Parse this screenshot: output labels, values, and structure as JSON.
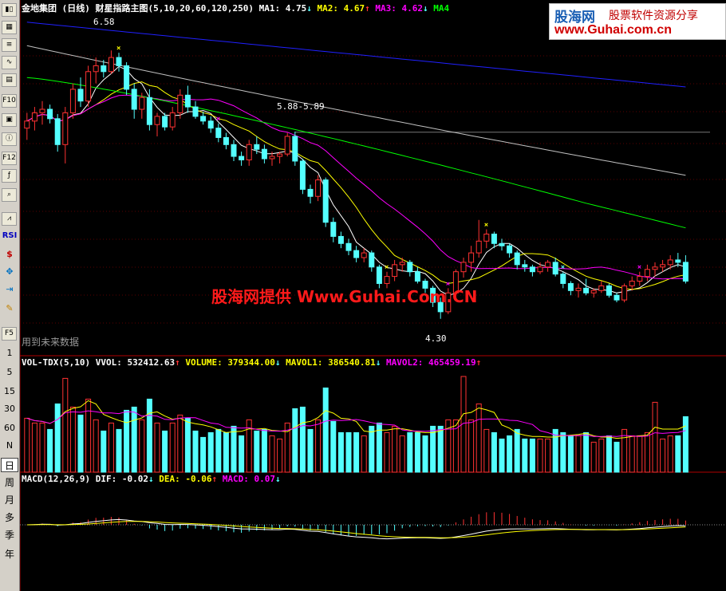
{
  "toolbar": {
    "icon_names": [
      "kline-icon",
      "table-icon",
      "report-icon",
      "fenshi-icon",
      "fundamentals-icon",
      "sector-icon",
      "f10-icon",
      "f9-icon",
      "info-icon",
      "f12-icon",
      "formula-icon",
      "search-icon"
    ],
    "f10_label": "F10",
    "f12_label": "F12",
    "rsi_label": "RSI",
    "f5_label": "F5",
    "minutes": [
      "1",
      "5",
      "15",
      "30",
      "60",
      "N"
    ],
    "periods": [
      "日",
      "周",
      "月",
      "多",
      "季",
      "年"
    ],
    "active_period": "日"
  },
  "main_legend": {
    "title": "金地集团 (日线)",
    "indicator": "财星指路主图(5,10,20,60,120,250)",
    "ma1_label": "MA1:",
    "ma1_value": "4.75",
    "ma1_arrow": "↓",
    "ma2_label": "MA2:",
    "ma2_value": "4.67",
    "ma2_arrow": "↑",
    "ma3_label": "MA3:",
    "ma3_value": "4.62",
    "ma3_arrow": "↓",
    "ma4_label": "MA4"
  },
  "price_annotations": {
    "high": "6.58",
    "range": "5.88-5.89",
    "low": "4.30"
  },
  "future_note": "用到未来数据",
  "volume_legend": {
    "name": "VOL-TDX(5,10)",
    "vvol_label": "VVOL:",
    "vvol_value": "532412.63",
    "vvol_arrow": "↑",
    "volume_label": "VOLUME:",
    "volume_value": "379344.00",
    "volume_arrow": "↓",
    "mavol1_label": "MAVOL1:",
    "mavol1_value": "386540.81",
    "mavol1_arrow": "↓",
    "mavol2_label": "MAVOL2:",
    "mavol2_value": "465459.19",
    "mavol2_arrow": "↑"
  },
  "macd_legend": {
    "name": "MACD(12,26,9)",
    "dif_label": "DIF:",
    "dif_value": "-0.02",
    "dif_arrow": "↓",
    "dea_label": "DEA:",
    "dea_value": "-0.06",
    "dea_arrow": "↑",
    "macd_label": "MACD:",
    "macd_value": "0.07",
    "macd_arrow": "↓"
  },
  "watermark": {
    "logo": "股海网",
    "slogan": "股票软件资源分享",
    "url": "www.Guhai.com.cn",
    "center": "股海网提供 Www.Guhai.Com.CN"
  },
  "colors": {
    "up": "#ff3232",
    "down": "#54ffff",
    "ma5": "#ffffff",
    "ma10": "#ffff00",
    "ma20": "#ff00ff",
    "ma60": "#00ff00",
    "ma120": "#c0c0c0",
    "ma250": "#2020ff",
    "panel_border": "#b00000"
  },
  "chart_data": [
    {
      "type": "candlestick",
      "title": "金地集团 (日线)",
      "price_high": 6.58,
      "price_low": 4.3,
      "range_label_values": [
        5.88,
        5.89
      ],
      "ma_latest": {
        "MA1": 4.75,
        "MA2": 4.67,
        "MA3": 4.62
      },
      "candles": [
        {
          "o": 5.92,
          "h": 6.05,
          "l": 5.82,
          "c": 5.98
        },
        {
          "o": 5.98,
          "h": 6.1,
          "l": 5.9,
          "c": 6.05
        },
        {
          "o": 6.05,
          "h": 6.15,
          "l": 5.95,
          "c": 6.08
        },
        {
          "o": 6.08,
          "h": 6.12,
          "l": 5.96,
          "c": 6.0
        },
        {
          "o": 6.0,
          "h": 6.04,
          "l": 5.72,
          "c": 5.78
        },
        {
          "o": 5.78,
          "h": 6.1,
          "l": 5.62,
          "c": 6.05
        },
        {
          "o": 6.05,
          "h": 6.3,
          "l": 6.0,
          "c": 6.25
        },
        {
          "o": 6.25,
          "h": 6.35,
          "l": 6.1,
          "c": 6.15
        },
        {
          "o": 6.15,
          "h": 6.45,
          "l": 6.1,
          "c": 6.4
        },
        {
          "o": 6.4,
          "h": 6.52,
          "l": 6.3,
          "c": 6.45
        },
        {
          "o": 6.45,
          "h": 6.5,
          "l": 6.35,
          "c": 6.4
        },
        {
          "o": 6.4,
          "h": 6.58,
          "l": 6.38,
          "c": 6.52
        },
        {
          "o": 6.52,
          "h": 6.56,
          "l": 6.4,
          "c": 6.45
        },
        {
          "o": 6.45,
          "h": 6.48,
          "l": 6.2,
          "c": 6.25
        },
        {
          "o": 6.25,
          "h": 6.3,
          "l": 6.0,
          "c": 6.08
        },
        {
          "o": 6.08,
          "h": 6.22,
          "l": 6.0,
          "c": 6.18
        },
        {
          "o": 6.18,
          "h": 6.25,
          "l": 5.9,
          "c": 5.95
        },
        {
          "o": 5.95,
          "h": 6.05,
          "l": 5.85,
          "c": 6.02
        },
        {
          "o": 6.02,
          "h": 6.05,
          "l": 5.9,
          "c": 5.93
        },
        {
          "o": 5.93,
          "h": 6.1,
          "l": 5.9,
          "c": 6.05
        },
        {
          "o": 6.05,
          "h": 6.25,
          "l": 6.0,
          "c": 6.2
        },
        {
          "o": 6.2,
          "h": 6.28,
          "l": 6.05,
          "c": 6.1
        },
        {
          "o": 6.1,
          "h": 6.15,
          "l": 6.0,
          "c": 6.02
        },
        {
          "o": 6.02,
          "h": 6.06,
          "l": 5.95,
          "c": 5.98
        },
        {
          "o": 5.98,
          "h": 6.02,
          "l": 5.88,
          "c": 5.92
        },
        {
          "o": 5.92,
          "h": 5.96,
          "l": 5.8,
          "c": 5.84
        },
        {
          "o": 5.84,
          "h": 5.88,
          "l": 5.74,
          "c": 5.78
        },
        {
          "o": 5.78,
          "h": 5.82,
          "l": 5.64,
          "c": 5.68
        },
        {
          "o": 5.68,
          "h": 5.72,
          "l": 5.6,
          "c": 5.65
        },
        {
          "o": 5.65,
          "h": 5.82,
          "l": 5.6,
          "c": 5.78
        },
        {
          "o": 5.78,
          "h": 5.85,
          "l": 5.7,
          "c": 5.74
        },
        {
          "o": 5.74,
          "h": 5.78,
          "l": 5.62,
          "c": 5.66
        },
        {
          "o": 5.66,
          "h": 5.72,
          "l": 5.6,
          "c": 5.68
        },
        {
          "o": 5.68,
          "h": 5.72,
          "l": 5.62,
          "c": 5.7
        },
        {
          "o": 5.7,
          "h": 5.88,
          "l": 5.68,
          "c": 5.85
        },
        {
          "o": 5.85,
          "h": 5.89,
          "l": 5.6,
          "c": 5.64
        },
        {
          "o": 5.64,
          "h": 5.66,
          "l": 5.36,
          "c": 5.4
        },
        {
          "o": 5.4,
          "h": 5.44,
          "l": 5.28,
          "c": 5.34
        },
        {
          "o": 5.34,
          "h": 5.52,
          "l": 5.3,
          "c": 5.48
        },
        {
          "o": 5.48,
          "h": 5.5,
          "l": 5.08,
          "c": 5.12
        },
        {
          "o": 5.12,
          "h": 5.16,
          "l": 4.95,
          "c": 5.0
        },
        {
          "o": 5.0,
          "h": 5.04,
          "l": 4.9,
          "c": 4.94
        },
        {
          "o": 4.94,
          "h": 4.98,
          "l": 4.84,
          "c": 4.88
        },
        {
          "o": 4.88,
          "h": 4.92,
          "l": 4.78,
          "c": 4.82
        },
        {
          "o": 4.82,
          "h": 4.9,
          "l": 4.78,
          "c": 4.86
        },
        {
          "o": 4.86,
          "h": 4.88,
          "l": 4.7,
          "c": 4.74
        },
        {
          "o": 4.74,
          "h": 4.76,
          "l": 4.56,
          "c": 4.6
        },
        {
          "o": 4.6,
          "h": 4.7,
          "l": 4.56,
          "c": 4.66
        },
        {
          "o": 4.66,
          "h": 4.8,
          "l": 4.62,
          "c": 4.76
        },
        {
          "o": 4.76,
          "h": 4.82,
          "l": 4.7,
          "c": 4.78
        },
        {
          "o": 4.78,
          "h": 4.8,
          "l": 4.66,
          "c": 4.7
        },
        {
          "o": 4.7,
          "h": 4.74,
          "l": 4.6,
          "c": 4.62
        },
        {
          "o": 4.62,
          "h": 4.64,
          "l": 4.52,
          "c": 4.56
        },
        {
          "o": 4.56,
          "h": 4.58,
          "l": 4.4,
          "c": 4.44
        },
        {
          "o": 4.44,
          "h": 4.48,
          "l": 4.3,
          "c": 4.36
        },
        {
          "o": 4.36,
          "h": 4.56,
          "l": 4.34,
          "c": 4.52
        },
        {
          "o": 4.52,
          "h": 4.72,
          "l": 4.5,
          "c": 4.7
        },
        {
          "o": 4.7,
          "h": 4.82,
          "l": 4.65,
          "c": 4.78
        },
        {
          "o": 4.78,
          "h": 4.92,
          "l": 4.7,
          "c": 4.86
        },
        {
          "o": 4.86,
          "h": 5.14,
          "l": 4.82,
          "c": 4.96
        },
        {
          "o": 4.96,
          "h": 5.06,
          "l": 4.9,
          "c": 5.02
        },
        {
          "o": 5.02,
          "h": 5.04,
          "l": 4.9,
          "c": 4.94
        },
        {
          "o": 4.94,
          "h": 4.98,
          "l": 4.88,
          "c": 4.92
        },
        {
          "o": 4.92,
          "h": 4.94,
          "l": 4.82,
          "c": 4.86
        },
        {
          "o": 4.86,
          "h": 4.88,
          "l": 4.72,
          "c": 4.76
        },
        {
          "o": 4.76,
          "h": 4.8,
          "l": 4.7,
          "c": 4.74
        },
        {
          "o": 4.74,
          "h": 4.76,
          "l": 4.66,
          "c": 4.7
        },
        {
          "o": 4.7,
          "h": 4.78,
          "l": 4.68,
          "c": 4.74
        },
        {
          "o": 4.74,
          "h": 4.8,
          "l": 4.7,
          "c": 4.78
        },
        {
          "o": 4.78,
          "h": 4.82,
          "l": 4.66,
          "c": 4.68
        },
        {
          "o": 4.68,
          "h": 4.7,
          "l": 4.56,
          "c": 4.6
        },
        {
          "o": 4.6,
          "h": 4.62,
          "l": 4.5,
          "c": 4.54
        },
        {
          "o": 4.54,
          "h": 4.6,
          "l": 4.48,
          "c": 4.56
        },
        {
          "o": 4.56,
          "h": 4.64,
          "l": 4.5,
          "c": 4.52
        },
        {
          "o": 4.52,
          "h": 4.56,
          "l": 4.48,
          "c": 4.54
        },
        {
          "o": 4.54,
          "h": 4.62,
          "l": 4.52,
          "c": 4.58
        },
        {
          "o": 4.58,
          "h": 4.6,
          "l": 4.48,
          "c": 4.5
        },
        {
          "o": 4.5,
          "h": 4.52,
          "l": 4.44,
          "c": 4.46
        },
        {
          "o": 4.46,
          "h": 4.6,
          "l": 4.44,
          "c": 4.58
        },
        {
          "o": 4.58,
          "h": 4.66,
          "l": 4.54,
          "c": 4.62
        },
        {
          "o": 4.62,
          "h": 4.7,
          "l": 4.58,
          "c": 4.66
        },
        {
          "o": 4.66,
          "h": 4.76,
          "l": 4.62,
          "c": 4.72
        },
        {
          "o": 4.72,
          "h": 4.78,
          "l": 4.66,
          "c": 4.74
        },
        {
          "o": 4.74,
          "h": 4.8,
          "l": 4.7,
          "c": 4.76
        },
        {
          "o": 4.76,
          "h": 4.84,
          "l": 4.72,
          "c": 4.8
        },
        {
          "o": 4.8,
          "h": 4.86,
          "l": 4.74,
          "c": 4.78
        },
        {
          "o": 4.78,
          "h": 4.84,
          "l": 4.6,
          "c": 4.62
        }
      ]
    },
    {
      "type": "bar",
      "title": "VOL-TDX(5,10)",
      "VVOL": 532412.63,
      "VOLUME": 379344.0,
      "MAVOL1": 386540.81,
      "MAVOL2": 465459.19
    },
    {
      "type": "bar",
      "title": "MACD(12,26,9)",
      "DIF": -0.02,
      "DEA": -0.06,
      "MACD": 0.07
    }
  ]
}
